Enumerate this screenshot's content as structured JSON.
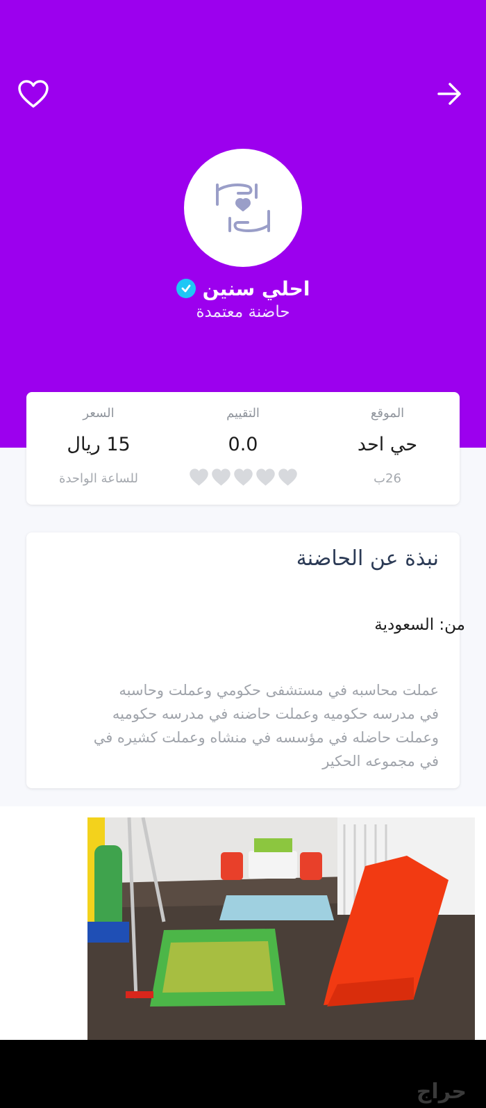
{
  "header": {
    "name": "احلي سنين",
    "subtitle": "حاضنة معتمدة",
    "bg_color": "#9c00ee"
  },
  "icons": {
    "favorite": "heart-outline-icon",
    "back": "arrow-right-icon",
    "avatar": "caring-hands-heart-icon",
    "verified": "verified-check-icon"
  },
  "stats": {
    "location": {
      "label": "الموقع",
      "value": "حي احد",
      "sub": "26ب"
    },
    "rating": {
      "label": "التقييم",
      "value": "0.0",
      "stars_total": 5,
      "stars_filled": 0
    },
    "price": {
      "label": "السعر",
      "value": "15 ريال",
      "sub": "للساعة الواحدة"
    }
  },
  "about": {
    "title": "نبذة عن الحاضنة",
    "from": "من: السعودية",
    "body_lines": [
      "عملت محاسبه في مستشفى حكومي وعملت  وحاسبه",
      "في مدرسه حكوميه وعملت حاضنه في مدرسه حكوميه",
      "وعملت حاضله في مؤسسه في منشاه وعملت كشيره في",
      "في مجموعه الحكير"
    ]
  },
  "photo": {
    "description_icon": "playroom-photo"
  },
  "watermark": {
    "text": "حراج"
  }
}
